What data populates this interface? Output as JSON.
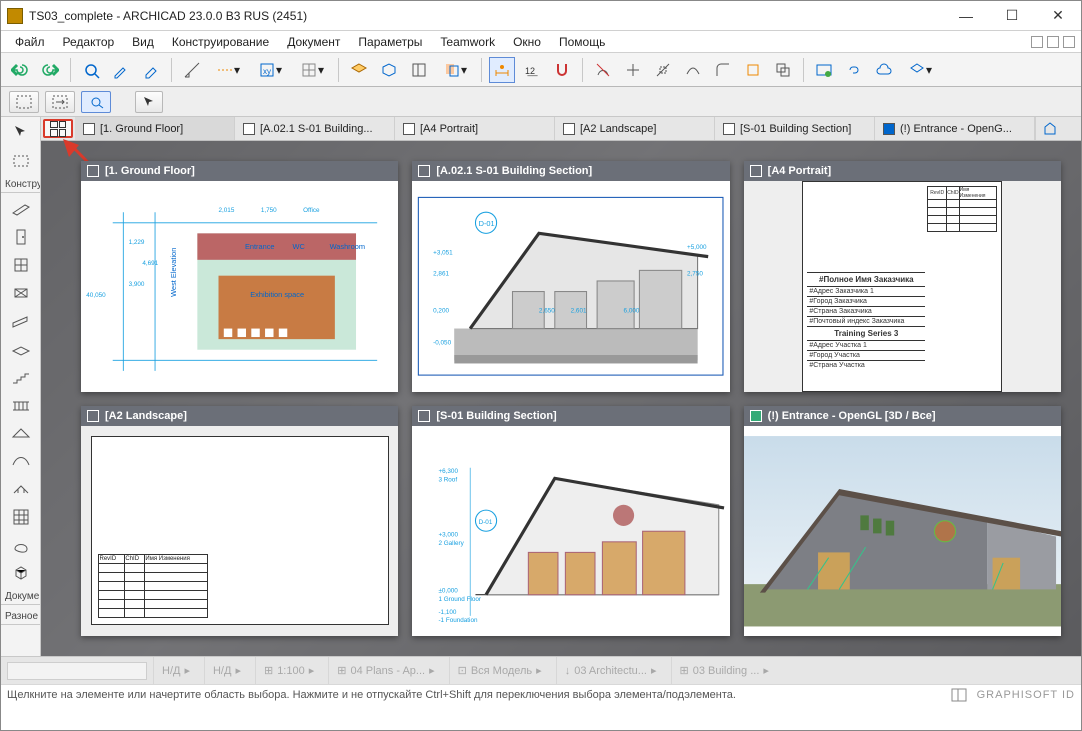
{
  "titlebar": {
    "title": "TS03_complete - ARCHICAD 23.0.0 B3 RUS (2451)"
  },
  "menu": {
    "items": [
      "Файл",
      "Редактор",
      "Вид",
      "Конструирование",
      "Документ",
      "Параметры",
      "Teamwork",
      "Окно",
      "Помощь"
    ]
  },
  "tabs": [
    {
      "label": "[1. Ground Floor]",
      "icon": "plan"
    },
    {
      "label": "[A.02.1 S-01 Building...",
      "icon": "layout"
    },
    {
      "label": "[A4 Portrait]",
      "icon": "layout"
    },
    {
      "label": "[A2 Landscape]",
      "icon": "layout"
    },
    {
      "label": "[S-01 Building Section]",
      "icon": "section"
    },
    {
      "label": "(!) Entrance - OpenG...",
      "icon": "3d"
    }
  ],
  "thumbs": [
    {
      "title": "[1. Ground Floor]",
      "kind": "plan"
    },
    {
      "title": "[A.02.1 S-01 Building Section]",
      "kind": "section"
    },
    {
      "title": "[A4 Portrait]",
      "kind": "sheet"
    },
    {
      "title": "[A2 Landscape]",
      "kind": "sheet2"
    },
    {
      "title": "[S-01 Building Section]",
      "kind": "section2"
    },
    {
      "title": "(!) Entrance - OpenGL [3D / Все]",
      "kind": "3d"
    }
  ],
  "sheet_a4": {
    "client_header": "#Полное Имя Заказчика",
    "rows": [
      "#Адрес Заказчика 1",
      "#Город Заказчика",
      "#Страна Заказчика",
      "#Почтовый индекс Заказчика"
    ],
    "series": "Training Series 3",
    "rows2": [
      "#Адрес Участка 1",
      "#Город Участка",
      "#Страна Участка"
    ],
    "cols": [
      "RevID",
      "ChID",
      "Имя Изменения"
    ]
  },
  "sheet_a2": {
    "cols": [
      "RevID",
      "ChID",
      "Имя Изменения"
    ]
  },
  "rail": {
    "top": "Констру",
    "bottom": "Докуме",
    "bottom2": "Разное"
  },
  "footer": {
    "nd1": "Н/Д",
    "nd2": "Н/Д",
    "scale": "1:100",
    "plans": "04 Plans - Ap...",
    "model": "Вся Модель",
    "arch": "03 Architectu...",
    "building": "03 Building ..."
  },
  "hint": {
    "text": "Щелкните на элементе или начертите область выбора. Нажмите и не отпускайте Ctrl+Shift для переключения выбора элемента/подэлемента.",
    "brand": "GRAPHISOFT ID"
  }
}
